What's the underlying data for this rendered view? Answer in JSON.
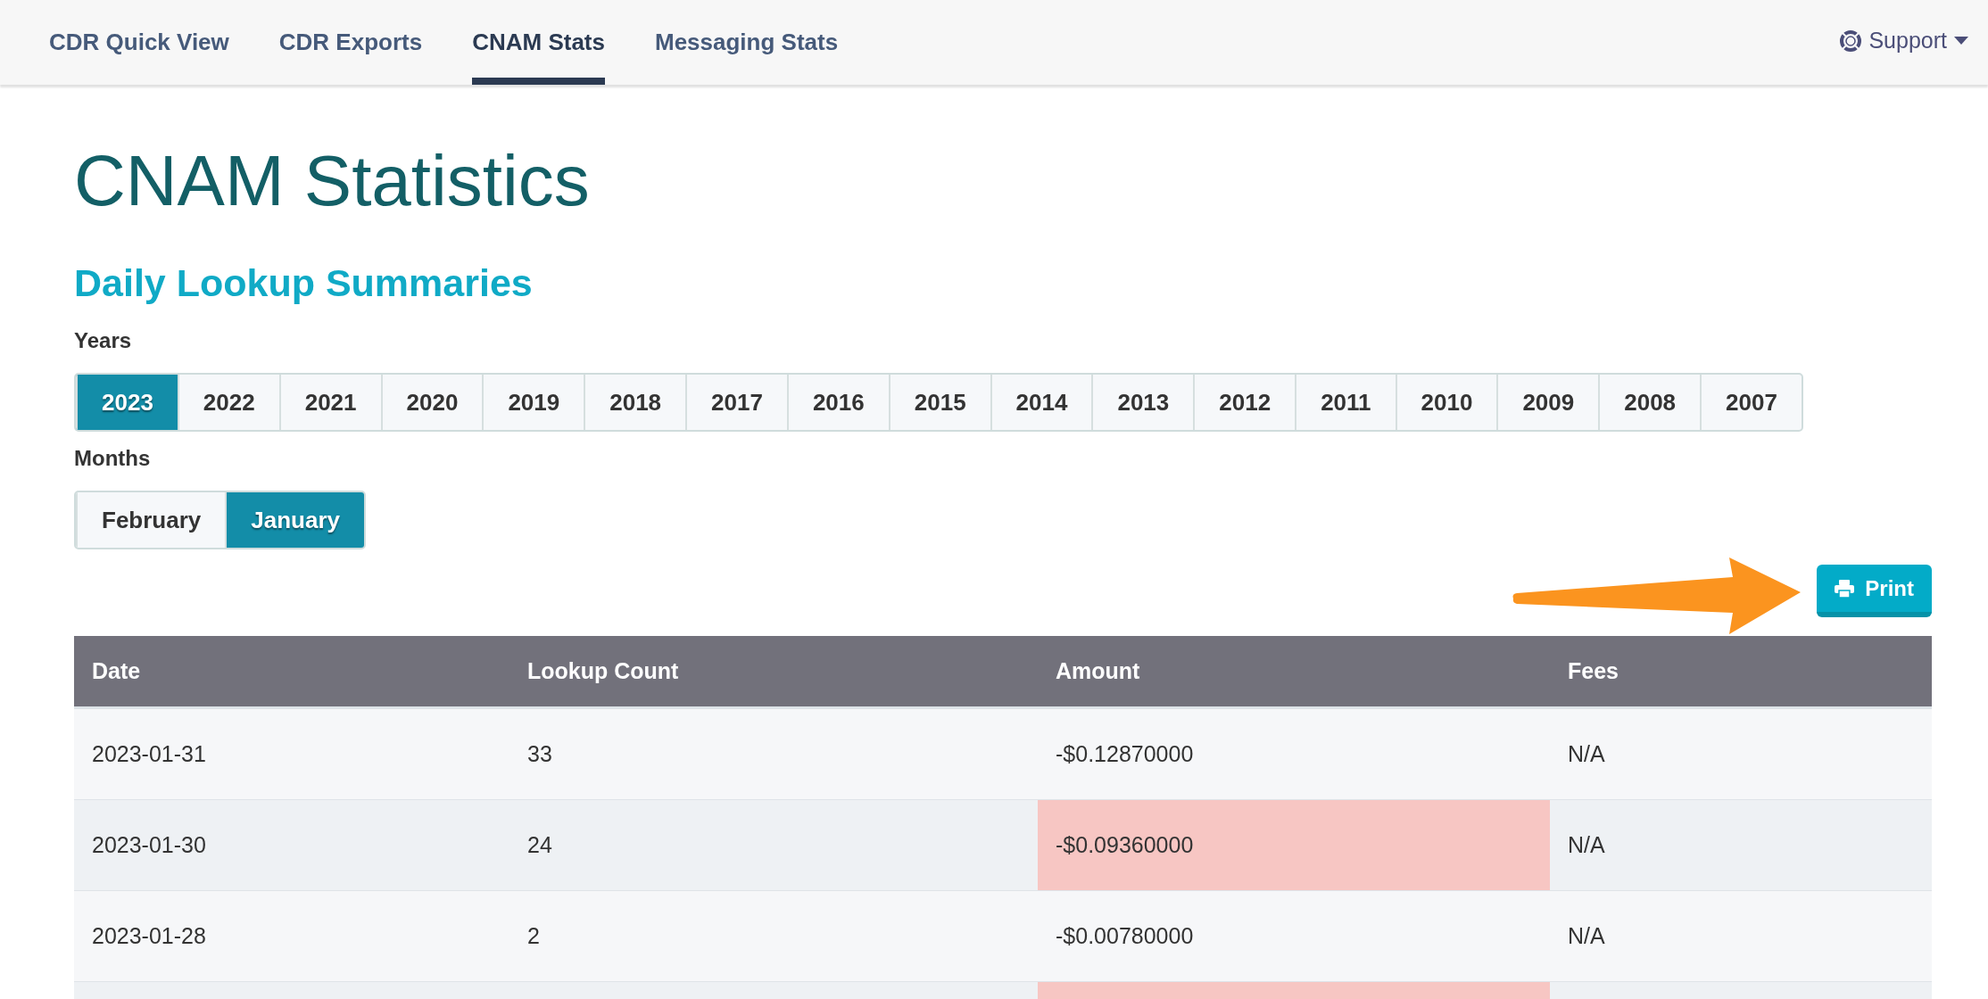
{
  "nav": {
    "tabs": [
      {
        "label": "CDR Quick View",
        "selected": false
      },
      {
        "label": "CDR Exports",
        "selected": false
      },
      {
        "label": "CNAM Stats",
        "selected": true
      },
      {
        "label": "Messaging Stats",
        "selected": false
      }
    ],
    "support": {
      "label": "Support"
    }
  },
  "title": "CNAM Statistics",
  "subtitle": "Daily Lookup Summaries",
  "years": {
    "label": "Years",
    "items": [
      {
        "label": "2023",
        "selected": true
      },
      {
        "label": "2022",
        "selected": false
      },
      {
        "label": "2021",
        "selected": false
      },
      {
        "label": "2020",
        "selected": false
      },
      {
        "label": "2019",
        "selected": false
      },
      {
        "label": "2018",
        "selected": false
      },
      {
        "label": "2017",
        "selected": false
      },
      {
        "label": "2016",
        "selected": false
      },
      {
        "label": "2015",
        "selected": false
      },
      {
        "label": "2014",
        "selected": false
      },
      {
        "label": "2013",
        "selected": false
      },
      {
        "label": "2012",
        "selected": false
      },
      {
        "label": "2011",
        "selected": false
      },
      {
        "label": "2010",
        "selected": false
      },
      {
        "label": "2009",
        "selected": false
      },
      {
        "label": "2008",
        "selected": false
      },
      {
        "label": "2007",
        "selected": false
      }
    ]
  },
  "months": {
    "label": "Months",
    "items": [
      {
        "label": "February",
        "selected": false
      },
      {
        "label": "January",
        "selected": true
      }
    ]
  },
  "print_button": {
    "label": "Print",
    "pointer_arrow": true
  },
  "table": {
    "columns": [
      "Date",
      "Lookup Count",
      "Amount",
      "Fees"
    ],
    "rows": [
      {
        "cells": [
          "2023-01-31",
          "33",
          "-$0.12870000",
          "N/A"
        ],
        "highlighted": false
      },
      {
        "cells": [
          "2023-01-30",
          "24",
          "-$0.09360000",
          "N/A"
        ],
        "highlighted": true
      },
      {
        "cells": [
          "2023-01-28",
          "2",
          "-$0.00780000",
          "N/A"
        ],
        "highlighted": false
      },
      {
        "cells": [],
        "highlighted": true
      }
    ]
  }
}
